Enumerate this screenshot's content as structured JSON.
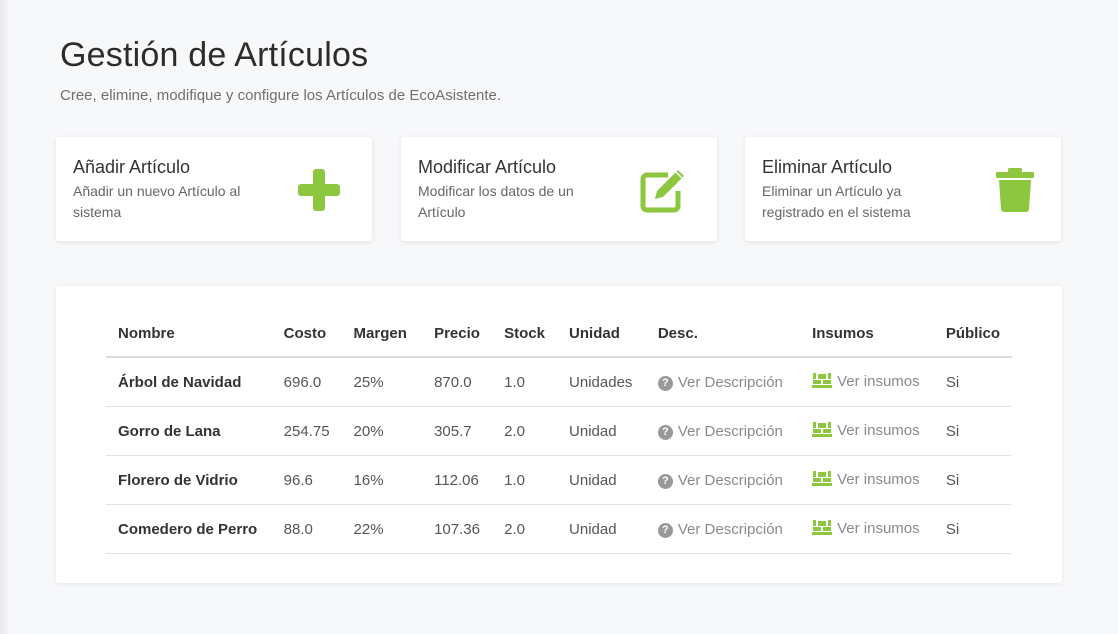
{
  "header": {
    "title": "Gestión de Artículos",
    "subtitle": "Cree, elimine, modifique y configure los Artículos de EcoAsistente."
  },
  "cards": [
    {
      "title": "Añadir Artículo",
      "description": "Añadir un nuevo Artículo al sistema",
      "icon": "plus-icon"
    },
    {
      "title": "Modificar Artículo",
      "description": "Modificar los datos de un Artículo",
      "icon": "edit-icon"
    },
    {
      "title": "Eliminar Artículo",
      "description": "Eliminar un Artículo ya registrado en el sistema",
      "icon": "trash-icon"
    }
  ],
  "colors": {
    "accent": "#8dc63f",
    "muted": "#999999"
  },
  "table": {
    "headers": [
      "Nombre",
      "Costo",
      "Margen",
      "Precio",
      "Stock",
      "Unidad",
      "Desc.",
      "Insumos",
      "Público"
    ],
    "rows": [
      {
        "nombre": "Árbol de Navidad",
        "costo": "696.0",
        "margen": "25%",
        "precio": "870.0",
        "stock": "1.0",
        "unidad": "Unidades",
        "desc": "Ver Descripción",
        "insumos": "Ver insumos",
        "publico": "Si"
      },
      {
        "nombre": "Gorro de Lana",
        "costo": "254.75",
        "margen": "20%",
        "precio": "305.7",
        "stock": "2.0",
        "unidad": "Unidad",
        "desc": "Ver Descripción",
        "insumos": "Ver insumos",
        "publico": "Si"
      },
      {
        "nombre": "Florero de Vidrio",
        "costo": "96.6",
        "margen": "16%",
        "precio": "112.06",
        "stock": "1.0",
        "unidad": "Unidad",
        "desc": "Ver Descripción",
        "insumos": "Ver insumos",
        "publico": "Si"
      },
      {
        "nombre": "Comedero de Perro",
        "costo": "88.0",
        "margen": "22%",
        "precio": "107.36",
        "stock": "2.0",
        "unidad": "Unidad",
        "desc": "Ver Descripción",
        "insumos": "Ver insumos",
        "publico": "Si"
      }
    ]
  }
}
